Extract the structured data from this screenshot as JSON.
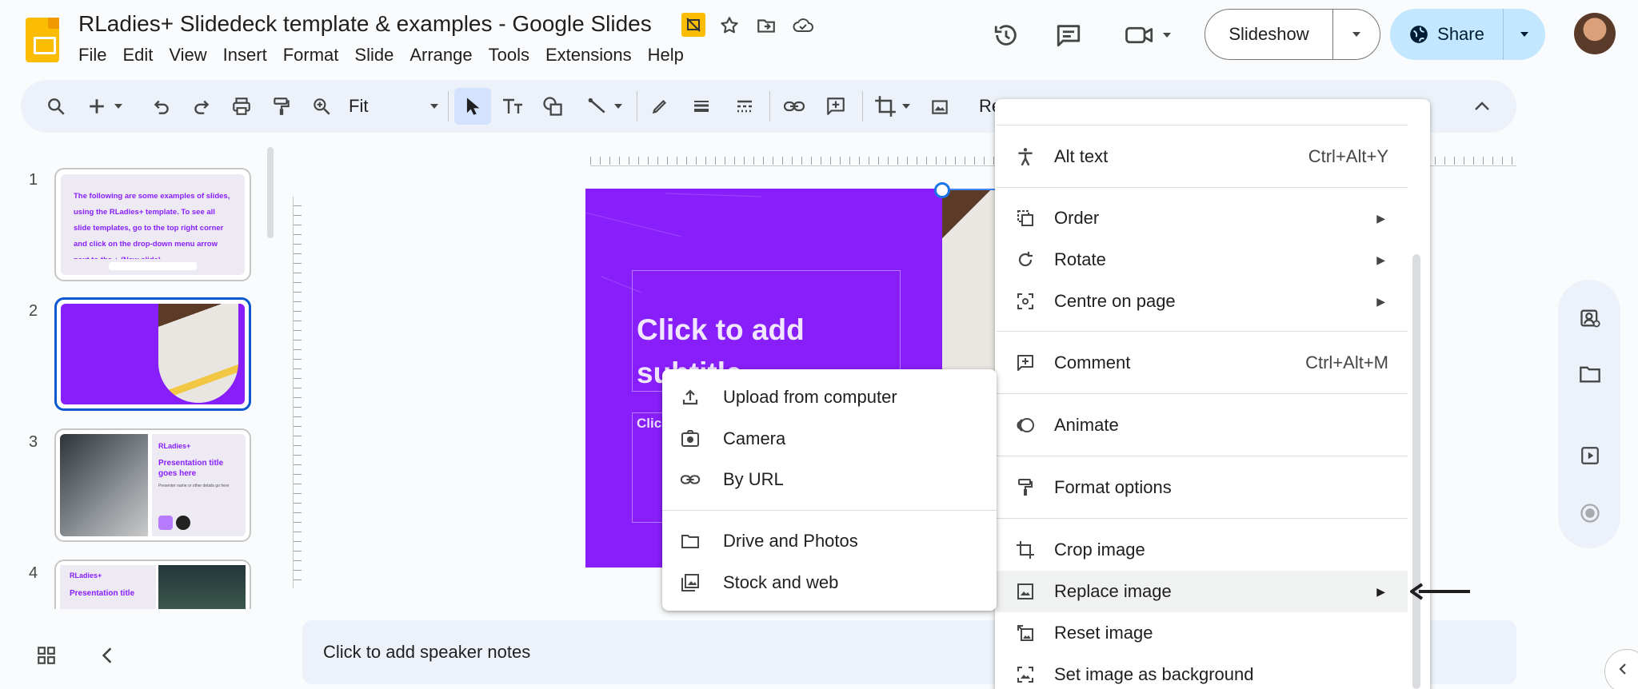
{
  "header": {
    "doc_title": "RLadies+ Slidedeck template & examples - Google Slides",
    "menu": [
      "File",
      "Edit",
      "View",
      "Insert",
      "Format",
      "Slide",
      "Arrange",
      "Tools",
      "Extensions",
      "Help"
    ],
    "slideshow_label": "Slideshow",
    "share_label": "Share"
  },
  "toolbar": {
    "zoom_value": "Fit",
    "partial_text": "Re"
  },
  "filmstrip": {
    "slides": [
      {
        "number": "1",
        "text": "The following are some examples of slides, using the RLadies+ template. To see all slide templates, go to the top right corner and click on the drop-down menu arrow next to the + (New slide)"
      },
      {
        "number": "2"
      },
      {
        "number": "3",
        "logo": "RLadies+",
        "title": "Presentation title goes here",
        "sub": "Presenter name or other details go here"
      },
      {
        "number": "4",
        "logo": "RLadies+",
        "title": "Presentation title"
      }
    ]
  },
  "slide": {
    "title": "Click to add subtitle",
    "subtitle_partial": "Clic"
  },
  "notes": {
    "placeholder": "Click to add speaker notes"
  },
  "context_menu": {
    "items": [
      {
        "label": "Alt text",
        "shortcut": "Ctrl+Alt+Y",
        "icon": "accessibility-icon"
      },
      {
        "label": "Order",
        "icon": "order-icon"
      },
      {
        "label": "Rotate",
        "icon": "rotate-icon"
      },
      {
        "label": "Centre on page",
        "icon": "center-icon"
      },
      {
        "label": "Comment",
        "shortcut": "Ctrl+Alt+M",
        "icon": "comment-add-icon"
      },
      {
        "label": "Animate",
        "icon": "animate-icon"
      },
      {
        "label": "Format options",
        "icon": "format-paint-icon"
      },
      {
        "label": "Crop image",
        "icon": "crop-icon"
      },
      {
        "label": "Replace image",
        "icon": "replace-image-icon"
      },
      {
        "label": "Reset image",
        "icon": "reset-image-icon"
      },
      {
        "label": "Set image as background",
        "icon": "background-image-icon"
      }
    ]
  },
  "submenu": {
    "items": [
      {
        "label": "Upload from computer",
        "icon": "upload-icon"
      },
      {
        "label": "Camera",
        "icon": "camera-icon"
      },
      {
        "label": "By URL",
        "icon": "link-icon"
      },
      {
        "label": "Drive and Photos",
        "icon": "folder-icon"
      },
      {
        "label": "Stock and web",
        "icon": "image-search-icon"
      }
    ]
  },
  "colors": {
    "accent": "#0b57d0",
    "slide_purple": "#881ef9",
    "share_bg": "#c2e7ff",
    "toolbar_bg": "#edf2fa"
  }
}
